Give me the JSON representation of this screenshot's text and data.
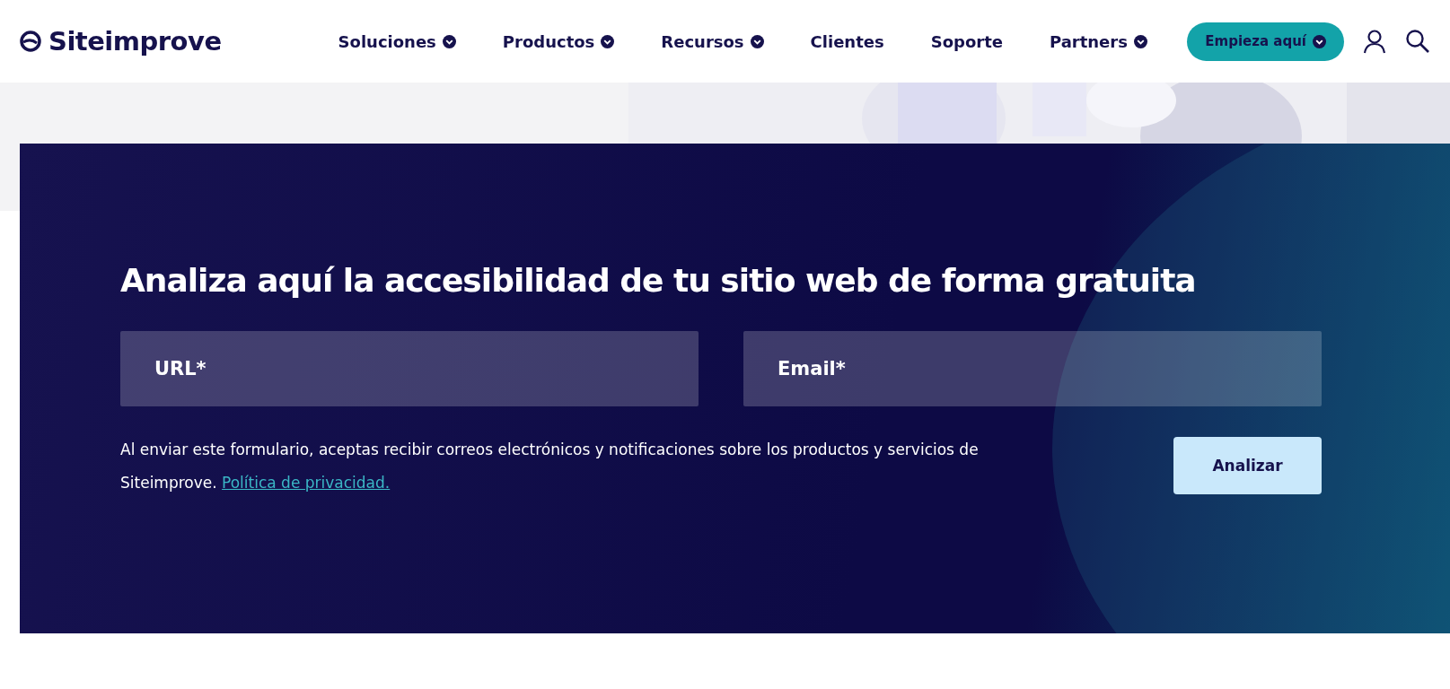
{
  "header": {
    "logo": "Siteimprove",
    "nav": [
      {
        "label": "Soluciones",
        "dropdown": true
      },
      {
        "label": "Productos",
        "dropdown": true
      },
      {
        "label": "Recursos",
        "dropdown": true
      },
      {
        "label": "Clientes",
        "dropdown": false
      },
      {
        "label": "Soporte",
        "dropdown": false
      },
      {
        "label": "Partners",
        "dropdown": true
      }
    ],
    "cta": {
      "label": "Empieza aquí",
      "dropdown": true
    }
  },
  "form": {
    "title": "Analiza aquí la accesibilidad de tu sitio web de forma gratuita",
    "fields": [
      {
        "placeholder": "URL*"
      },
      {
        "placeholder": "Email*"
      }
    ],
    "consent": "Al enviar este formulario, aceptas recibir correos electrónicos y notificaciones sobre los productos y servicios de Siteimprove.",
    "privacy_link": "Política de privacidad.",
    "submit": "Analizar"
  }
}
